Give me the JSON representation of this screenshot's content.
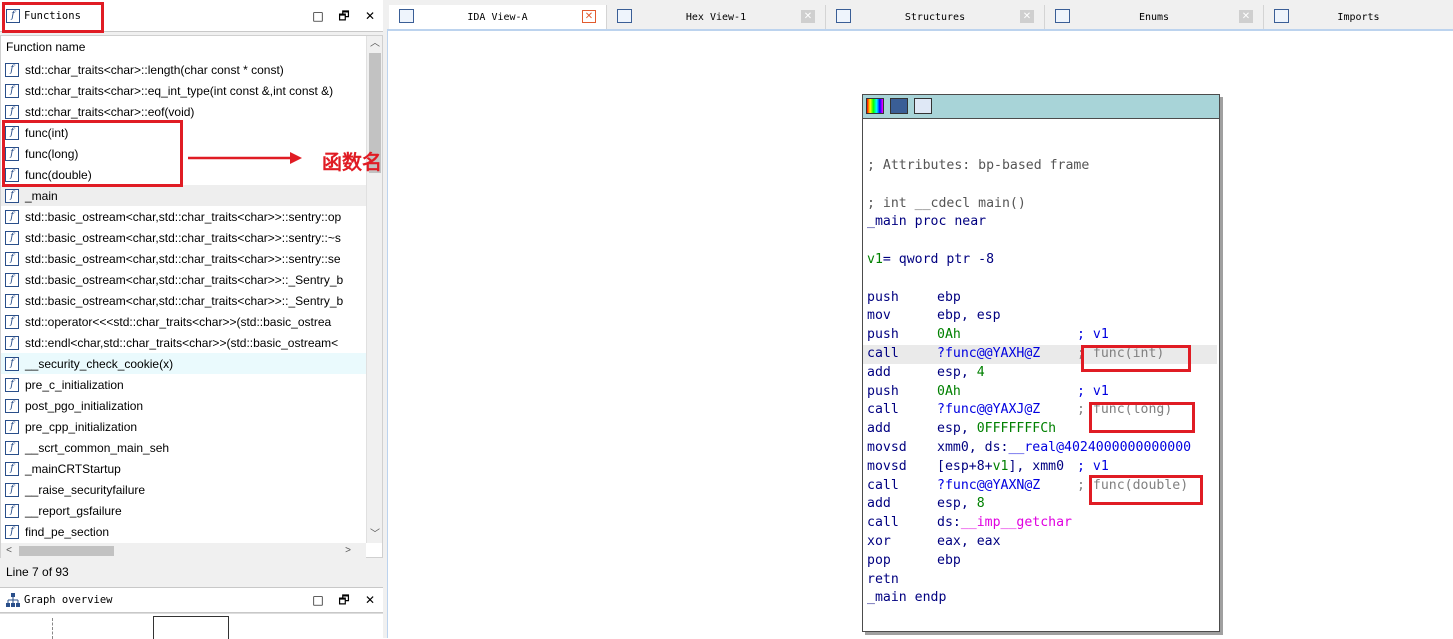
{
  "functions_panel": {
    "title": "Functions",
    "column_header": "Function name",
    "rows": [
      {
        "name": "std::char_traits<char>::length(char const * const)"
      },
      {
        "name": "std::char_traits<char>::eq_int_type(int const &,int const &)"
      },
      {
        "name": "std::char_traits<char>::eof(void)"
      },
      {
        "name": "func(int)"
      },
      {
        "name": "func(long)"
      },
      {
        "name": "func(double)"
      },
      {
        "name": "_main",
        "selected": true
      },
      {
        "name": "std::basic_ostream<char,std::char_traits<char>>::sentry::op"
      },
      {
        "name": "std::basic_ostream<char,std::char_traits<char>>::sentry::~s"
      },
      {
        "name": "std::basic_ostream<char,std::char_traits<char>>::sentry::se"
      },
      {
        "name": "std::basic_ostream<char,std::char_traits<char>>::_Sentry_b"
      },
      {
        "name": "std::basic_ostream<char,std::char_traits<char>>::_Sentry_b"
      },
      {
        "name": "std::operator<<<std::char_traits<char>>(std::basic_ostrea"
      },
      {
        "name": "std::endl<char,std::char_traits<char>>(std::basic_ostream<"
      },
      {
        "name": "__security_check_cookie(x)",
        "highlight": true
      },
      {
        "name": "pre_c_initialization"
      },
      {
        "name": "post_pgo_initialization"
      },
      {
        "name": "pre_cpp_initialization"
      },
      {
        "name": "__scrt_common_main_seh"
      },
      {
        "name": "_mainCRTStartup"
      },
      {
        "name": "__raise_securityfailure"
      },
      {
        "name": "__report_gsfailure"
      },
      {
        "name": "find_pe_section"
      }
    ],
    "status": "Line 7 of 93",
    "function_icon": "function-f-icon"
  },
  "graph_overview": {
    "title": "Graph overview",
    "icon": "graph-tree-icon"
  },
  "window_buttons": {
    "minimize": "□",
    "restore": "🗗",
    "close": "✕"
  },
  "annotation": {
    "label": "函数名",
    "color": "#e01c24"
  },
  "tabs": [
    {
      "label": "IDA View-A",
      "active": true,
      "icon": "ida-view-icon"
    },
    {
      "label": "Hex View-1",
      "active": false,
      "icon": "hex-view-icon"
    },
    {
      "label": "Structures",
      "active": false,
      "icon": "structures-icon"
    },
    {
      "label": "Enums",
      "active": false,
      "icon": "enums-icon"
    },
    {
      "label": "Imports",
      "active": false,
      "icon": "imports-icon"
    }
  ],
  "graph_node": {
    "header_icons": [
      "color-palette-icon",
      "edit-node-icon",
      "graph-layout-icon"
    ],
    "code": {
      "attr_comment": "; Attributes: bp-based frame",
      "sig_comment": "; int __cdecl main()",
      "proc_label": "_main",
      "proc_rest": " proc near",
      "var_name": "v1",
      "var_rest": "= qword ptr -8",
      "lines": [
        {
          "mn": "push",
          "op1": "ebp"
        },
        {
          "mn": "mov",
          "op1": "ebp, esp"
        },
        {
          "mn": "push",
          "imm": "0Ah",
          "cmt": "; v1"
        },
        {
          "mn": "call",
          "sym": "?func@@YAXH@Z",
          "cmt2": "func(int)",
          "hl": true
        },
        {
          "mn": "add",
          "op1": "esp, ",
          "imm": "4"
        },
        {
          "mn": "push",
          "imm": "0Ah",
          "cmt": "; v1"
        },
        {
          "mn": "call",
          "sym": "?func@@YAXJ@Z",
          "cmt2": "func(long)"
        },
        {
          "mn": "add",
          "op1": "esp, ",
          "imm": "0FFFFFFFCh"
        },
        {
          "mn": "movsd",
          "op1": "xmm0, ds:",
          "sym": "__real@4024000000000000"
        },
        {
          "mn": "movsd",
          "op1": "[esp+8+",
          "var": "v1",
          "op2": "], xmm0 ",
          "cmt": "; v1"
        },
        {
          "mn": "call",
          "sym": "?func@@YAXN@Z",
          "cmt2": "func(double)"
        },
        {
          "mn": "add",
          "op1": "esp, ",
          "imm": "8"
        },
        {
          "mn": "call",
          "op1": "ds:",
          "imp": "__imp__getchar"
        },
        {
          "mn": "xor",
          "op1": "eax, eax"
        },
        {
          "mn": "pop",
          "op1": "ebp"
        },
        {
          "mn": "retn"
        }
      ],
      "endp_label": "_main",
      "endp_rest": " endp"
    }
  }
}
